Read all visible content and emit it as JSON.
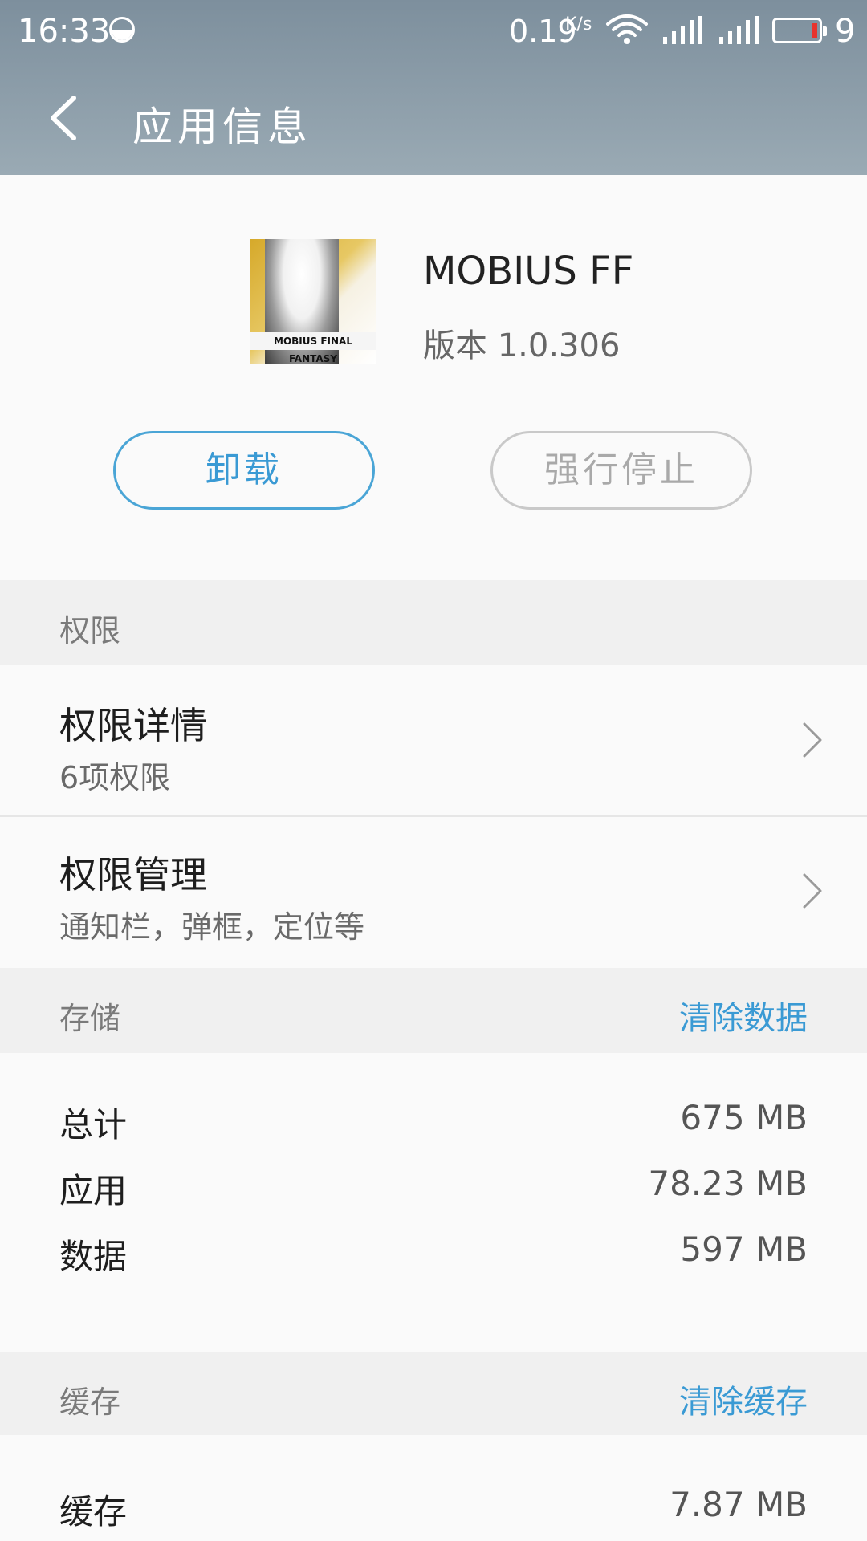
{
  "status_bar": {
    "time": "16:33",
    "net_speed": "0.19",
    "net_unit": "K/s",
    "battery_level": "9",
    "colors": {
      "battery_low": "#e8332d"
    }
  },
  "header": {
    "title": "应用信息",
    "back_icon": "chevron-left-icon"
  },
  "app": {
    "name": "MOBIUS FF",
    "version": "版本 1.0.306",
    "icon_banner_text": "MOBIUS FINAL FANTASY"
  },
  "actions": {
    "uninstall": "卸载",
    "force_stop": "强行停止"
  },
  "permissions": {
    "section_title": "权限",
    "details": {
      "title": "权限详情",
      "subtitle": "6项权限"
    },
    "manage": {
      "title": "权限管理",
      "subtitle": "通知栏，弹框，定位等"
    }
  },
  "storage": {
    "section_title": "存储",
    "action": "清除数据",
    "rows": [
      {
        "label": "总计",
        "value": "675 MB"
      },
      {
        "label": "应用",
        "value": "78.23 MB"
      },
      {
        "label": "数据",
        "value": "597 MB"
      }
    ]
  },
  "cache": {
    "section_title": "缓存",
    "action": "清除缓存",
    "rows": [
      {
        "label": "缓存",
        "value": "7.87 MB"
      }
    ]
  },
  "colors": {
    "accent": "#3a9ad4",
    "header_top": "#7d8f9d",
    "header_bottom": "#9aaab4"
  }
}
